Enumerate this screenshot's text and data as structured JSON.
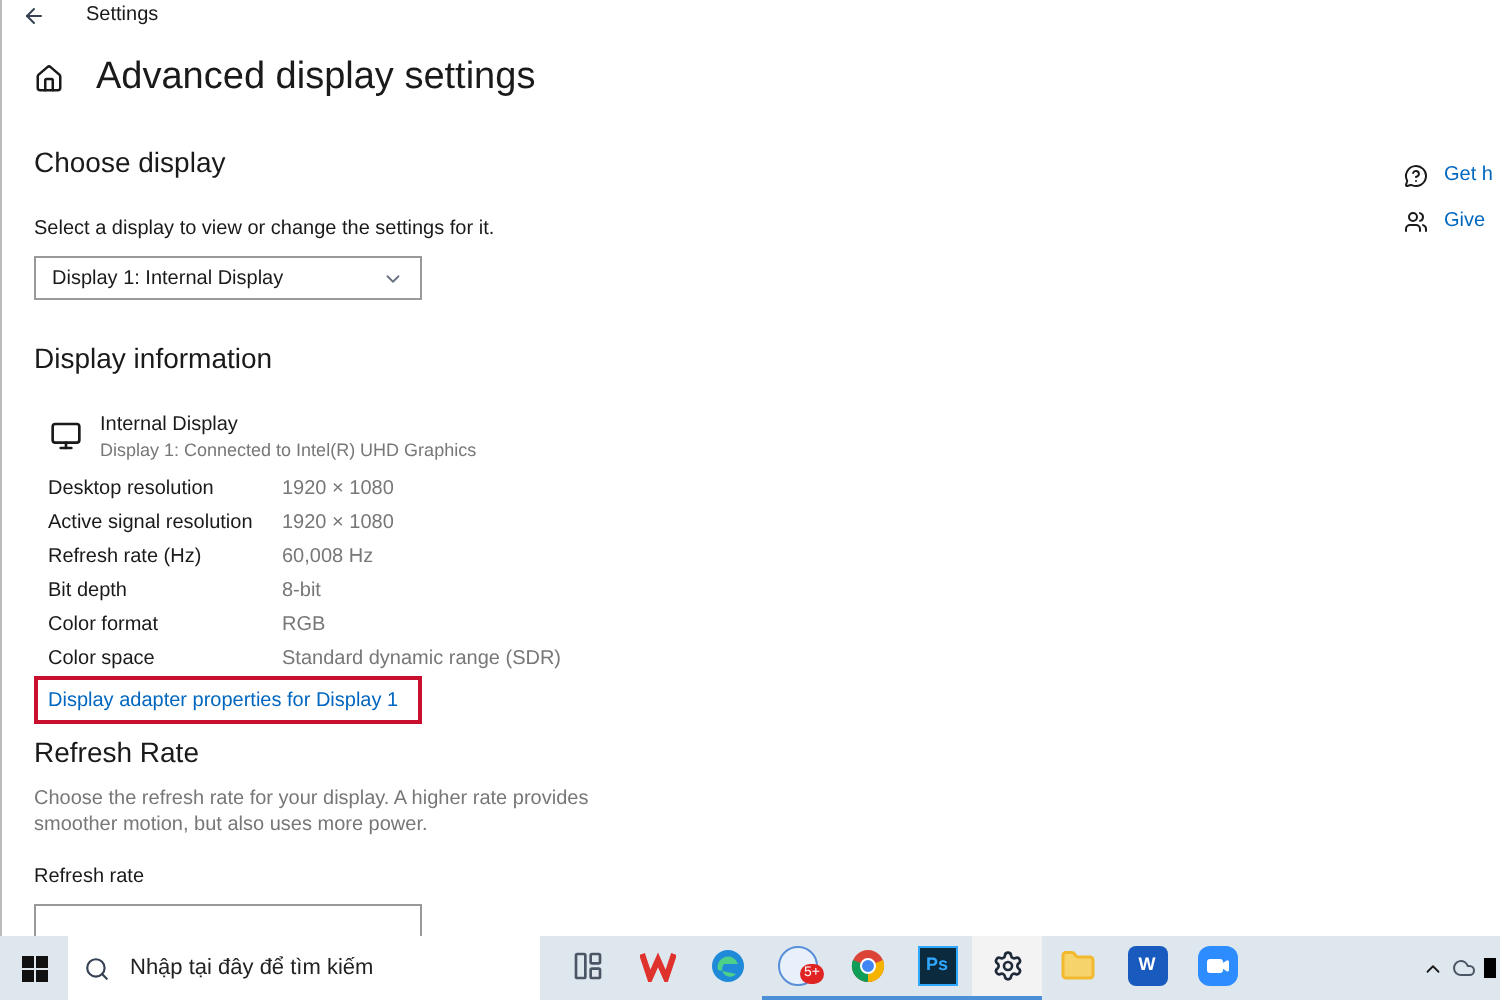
{
  "window": {
    "title": "Settings"
  },
  "page_title": "Advanced display settings",
  "choose_display": {
    "heading": "Choose display",
    "description": "Select a display to view or change the settings for it.",
    "dropdown": {
      "value": "Display 1: Internal Display"
    }
  },
  "display_information": {
    "heading": "Display information",
    "display_name": "Internal Display",
    "display_detail": "Display 1: Connected to Intel(R) UHD Graphics",
    "rows": [
      {
        "label": "Desktop resolution",
        "value": "1920 × 1080"
      },
      {
        "label": "Active signal resolution",
        "value": "1920 × 1080"
      },
      {
        "label": "Refresh rate (Hz)",
        "value": "60,008 Hz"
      },
      {
        "label": "Bit depth",
        "value": "8-bit"
      },
      {
        "label": "Color format",
        "value": "RGB"
      },
      {
        "label": "Color space",
        "value": "Standard dynamic range (SDR)"
      }
    ],
    "link": {
      "text": "Display adapter properties for Display 1",
      "highlighted": true
    }
  },
  "refresh_rate": {
    "heading": "Refresh Rate",
    "description": "Choose the refresh rate for your display. A higher rate provides smoother motion, but also uses more power.",
    "field_label": "Refresh rate"
  },
  "side_links": [
    {
      "kind": "help",
      "text": "Get h"
    },
    {
      "kind": "feedback",
      "text": "Give"
    }
  ],
  "taskbar": {
    "search_placeholder": "Nhập tại đây để tìm kiếm",
    "apps": [
      {
        "kind": "taskview",
        "running": false,
        "selected": false
      },
      {
        "kind": "wps",
        "running": false,
        "selected": false
      },
      {
        "kind": "edge",
        "running": false,
        "selected": false
      },
      {
        "kind": "zalo",
        "running": true,
        "selected": false,
        "badge": "5+"
      },
      {
        "kind": "chrome",
        "running": true,
        "selected": false
      },
      {
        "kind": "photoshop",
        "running": true,
        "selected": false,
        "label": "Ps"
      },
      {
        "kind": "settings",
        "running": true,
        "selected": true
      },
      {
        "kind": "explorer",
        "running": false,
        "selected": false
      },
      {
        "kind": "word",
        "running": false,
        "selected": false,
        "label": "W"
      },
      {
        "kind": "zoom",
        "running": false,
        "selected": false
      }
    ]
  }
}
